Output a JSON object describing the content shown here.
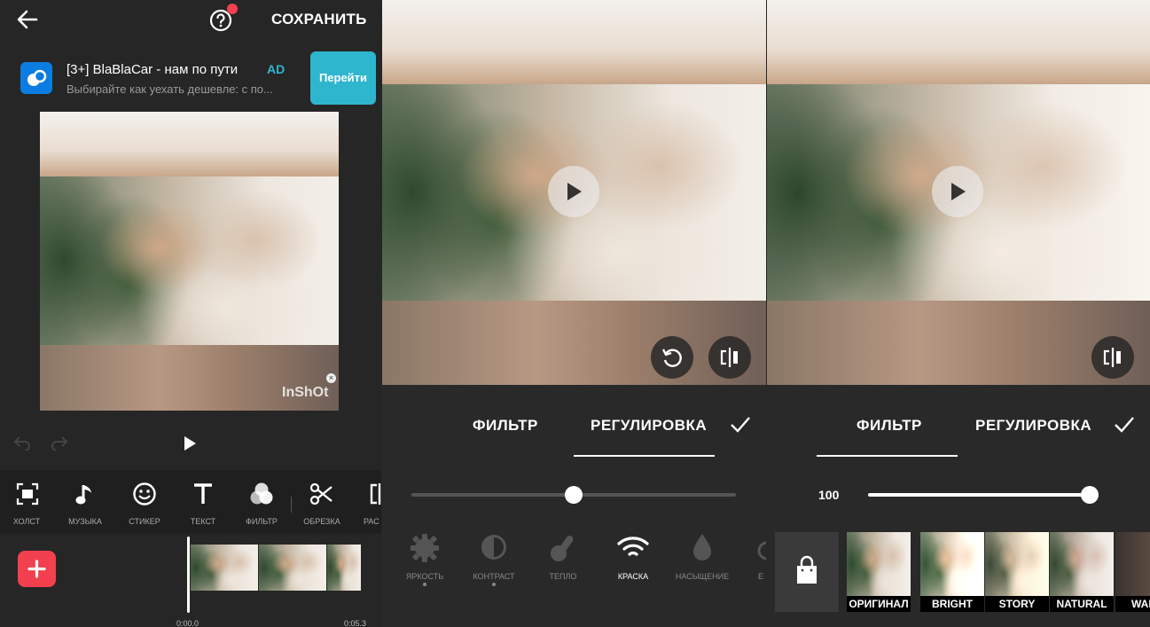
{
  "left_panel": {
    "save_label": "СОХРАНИТЬ",
    "ad": {
      "title": "[3+] BlaBlaCar - нам по пути",
      "badge": "AD",
      "subtitle": "Выбирайте как уехать дешевле: с по...",
      "cta_label": "Перейти"
    },
    "watermark": "InShOt",
    "toolbar": [
      {
        "label": "ХОЛСТ",
        "icon": "canvas-icon"
      },
      {
        "label": "МУЗЫКА",
        "icon": "music-note-icon"
      },
      {
        "label": "СТИКЕР",
        "icon": "smiley-icon"
      },
      {
        "label": "ТЕКСТ",
        "icon": "text-t-icon"
      },
      {
        "label": "ФИЛЬТР",
        "icon": "filter-circles-icon"
      },
      {
        "label": "ОБРЕЗКА",
        "icon": "scissors-icon"
      },
      {
        "label": "РАС",
        "icon": "split-icon"
      }
    ],
    "timeline": {
      "start_time": "0:00.0",
      "end_time": "0:05.3"
    }
  },
  "middle_panel": {
    "tabs": [
      "ФИЛЬТР",
      "РЕГУЛИРОВКА"
    ],
    "active_tab": "РЕГУЛИРОВКА",
    "slider_value_fraction": 0.5,
    "adjustments": [
      {
        "label": "ЯРКОСТЬ",
        "icon": "sun-gear-icon",
        "active": false,
        "dot": true
      },
      {
        "label": "КОНТРАСТ",
        "icon": "contrast-icon",
        "active": false,
        "dot": true
      },
      {
        "label": "ТЕПЛО",
        "icon": "thermometer-icon",
        "active": false,
        "dot": false
      },
      {
        "label": "КРАСКА",
        "icon": "wifi-arc-icon",
        "active": true,
        "dot": false
      },
      {
        "label": "НАСЫЩЕНИЕ",
        "icon": "drop-icon",
        "active": false,
        "dot": false
      },
      {
        "label": "Е",
        "icon": "partial-icon",
        "active": false,
        "dot": false
      }
    ]
  },
  "right_panel": {
    "tabs": [
      "ФИЛЬТР",
      "РЕГУЛИРОВКА"
    ],
    "active_tab": "ФИЛЬТР",
    "slider_value": "100",
    "slider_value_fraction": 1.0,
    "filters": [
      "ОРИГИНАЛ",
      "BRIGHT",
      "STORY",
      "NATURAL",
      "WAR"
    ]
  },
  "colors": {
    "accent_red": "#f2404f",
    "ad_button": "#2fb6cf",
    "background": "#262626"
  }
}
